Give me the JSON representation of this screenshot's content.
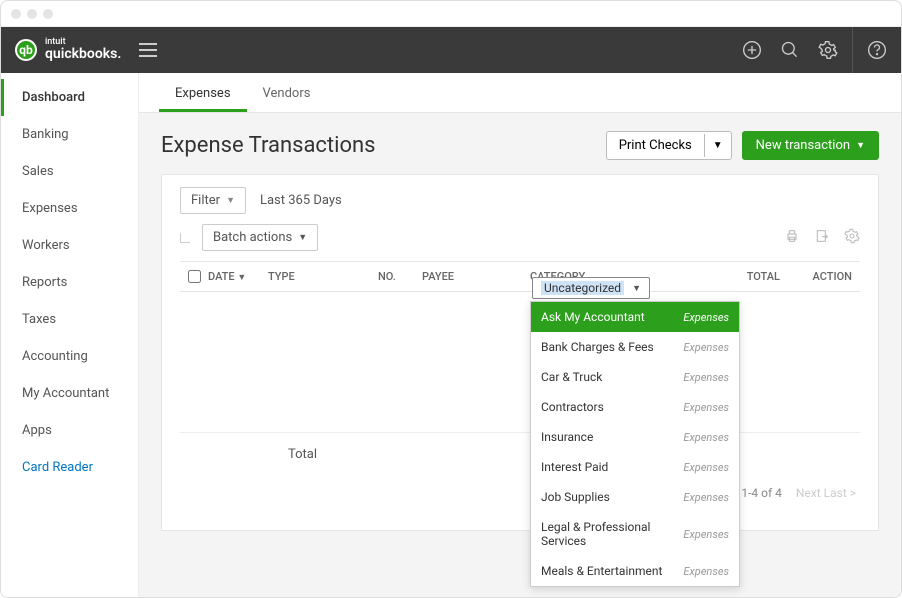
{
  "brand": {
    "name": "quickbooks.",
    "prefix": "intuit"
  },
  "sidebar": {
    "items": [
      {
        "label": "Dashboard",
        "active": true
      },
      {
        "label": "Banking"
      },
      {
        "label": "Sales"
      },
      {
        "label": "Expenses"
      },
      {
        "label": "Workers"
      },
      {
        "label": "Reports"
      },
      {
        "label": "Taxes"
      },
      {
        "label": "Accounting"
      },
      {
        "label": "My Accountant"
      },
      {
        "label": "Apps"
      },
      {
        "label": "Card Reader",
        "link": true
      }
    ]
  },
  "tabs": [
    {
      "label": "Expenses",
      "active": true
    },
    {
      "label": "Vendors"
    }
  ],
  "page": {
    "title": "Expense Transactions",
    "print_checks": "Print Checks",
    "new_transaction": "New transaction"
  },
  "filter": {
    "label": "Filter",
    "range": "Last 365 Days",
    "batch": "Batch actions"
  },
  "columns": {
    "date": "DATE",
    "type": "TYPE",
    "no": "NO.",
    "payee": "PAYEE",
    "category": "CATEGORY",
    "total": "TOTAL",
    "action": "ACTION"
  },
  "total_label": "Total",
  "pager": {
    "range": "1-4 of 4",
    "next": "Next Last >"
  },
  "category_select": {
    "selected": "Uncategorized",
    "options": [
      {
        "label": "Ask My Accountant",
        "type": "Expenses",
        "selected": true
      },
      {
        "label": "Bank Charges & Fees",
        "type": "Expenses"
      },
      {
        "label": "Car & Truck",
        "type": "Expenses"
      },
      {
        "label": "Contractors",
        "type": "Expenses"
      },
      {
        "label": "Insurance",
        "type": "Expenses"
      },
      {
        "label": "Interest Paid",
        "type": "Expenses"
      },
      {
        "label": "Job Supplies",
        "type": "Expenses"
      },
      {
        "label": "Legal & Professional Services",
        "type": "Expenses"
      },
      {
        "label": "Meals & Entertainment",
        "type": "Expenses"
      }
    ]
  }
}
